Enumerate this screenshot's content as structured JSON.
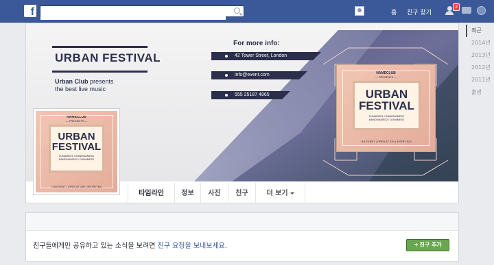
{
  "topbar": {
    "logo": "f",
    "search_value": "",
    "search_placeholder": "",
    "home_label": "홈",
    "find_friends_label": "친구 찾기",
    "friend_requests_badge": "2"
  },
  "cover": {
    "title": "URBAN FESTIVAL",
    "subtitle_brand": "Urban Club",
    "subtitle_rest": " presents",
    "subtitle_line2": "the best live music",
    "info_heading": "For more info:",
    "address": "42 Tower Street, London",
    "email": "info@event.com",
    "phone": "555 25187 4965",
    "poster": {
      "club": "NAMECLUB",
      "presents": "— PRESENTS —",
      "title_line1": "URBAN",
      "title_line2": "FESTIVAL",
      "lineup1": "DJNAME01 / BANDNAME01",
      "lineup2": "BANDNAME02 / DJNAME02",
      "footer": "+18 EVENT  |  OPEN AT 21H  |  ENTRY $20"
    }
  },
  "tabs": [
    {
      "label": "타임라인"
    },
    {
      "label": "정보"
    },
    {
      "label": "사진"
    },
    {
      "label": "친구"
    },
    {
      "label": "더 보기"
    }
  ],
  "years": [
    "최근",
    "2014년",
    "2013년",
    "2012년",
    "2011년",
    "출생"
  ],
  "stream": {
    "notice_text": "친구들에게만 공유하고 있는 소식을 보려면 ",
    "notice_link": "친구 요청을 보내보세요.",
    "add_friend_label": "친구 추가"
  },
  "colors": {
    "topbar": "#3b5998",
    "accent_dark": "#2b2f4c",
    "add_friend_green": "#69a74e"
  }
}
